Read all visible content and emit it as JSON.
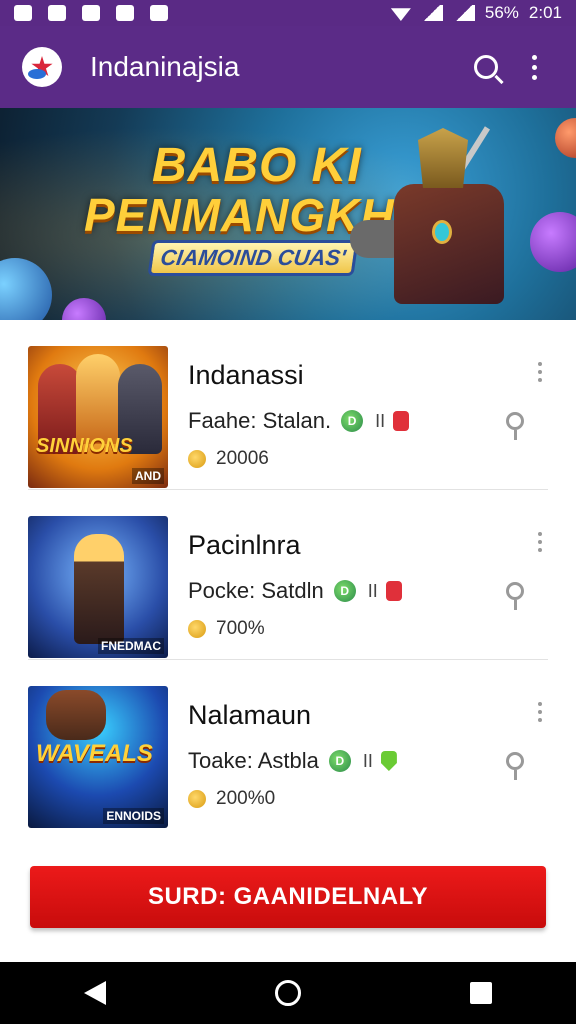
{
  "status_bar": {
    "battery": "56%",
    "time": "2:01"
  },
  "app_bar": {
    "title": "Indaninajsia",
    "icons": [
      "app-logo-icon",
      "search-icon",
      "more-vert-icon"
    ]
  },
  "banner": {
    "title_line1": "BABO KI",
    "title_line2": "PENMANGKH",
    "ribbon": "CIAMOIND CUAS'"
  },
  "items": [
    {
      "thumb_text": "SINNIONS",
      "thumb_tag": "AND",
      "title": "Indanassi",
      "subtitle": "Faahe: Stalan.",
      "badge": "D",
      "bars": "II",
      "tag_color": "#e0303a",
      "meta": "20006"
    },
    {
      "thumb_text": "",
      "thumb_tag": "FNEDMAC",
      "title": "Pacinlnra",
      "subtitle": "Pocke: Satdln",
      "badge": "D",
      "bars": "II",
      "tag_color": "#e0303a",
      "meta": "700%"
    },
    {
      "thumb_text": "WAVEALS",
      "thumb_tag": "ENNOIDS",
      "title": "Nalamaun",
      "subtitle": "Toake: Astbla",
      "badge": "D",
      "bars": "II",
      "tag_color": "#6acb34",
      "meta": "200%0"
    }
  ],
  "cta": {
    "label": "SURD: GAANIDELNALY"
  },
  "nav_bar": {
    "icons": [
      "back-icon",
      "home-icon",
      "recents-icon"
    ]
  }
}
